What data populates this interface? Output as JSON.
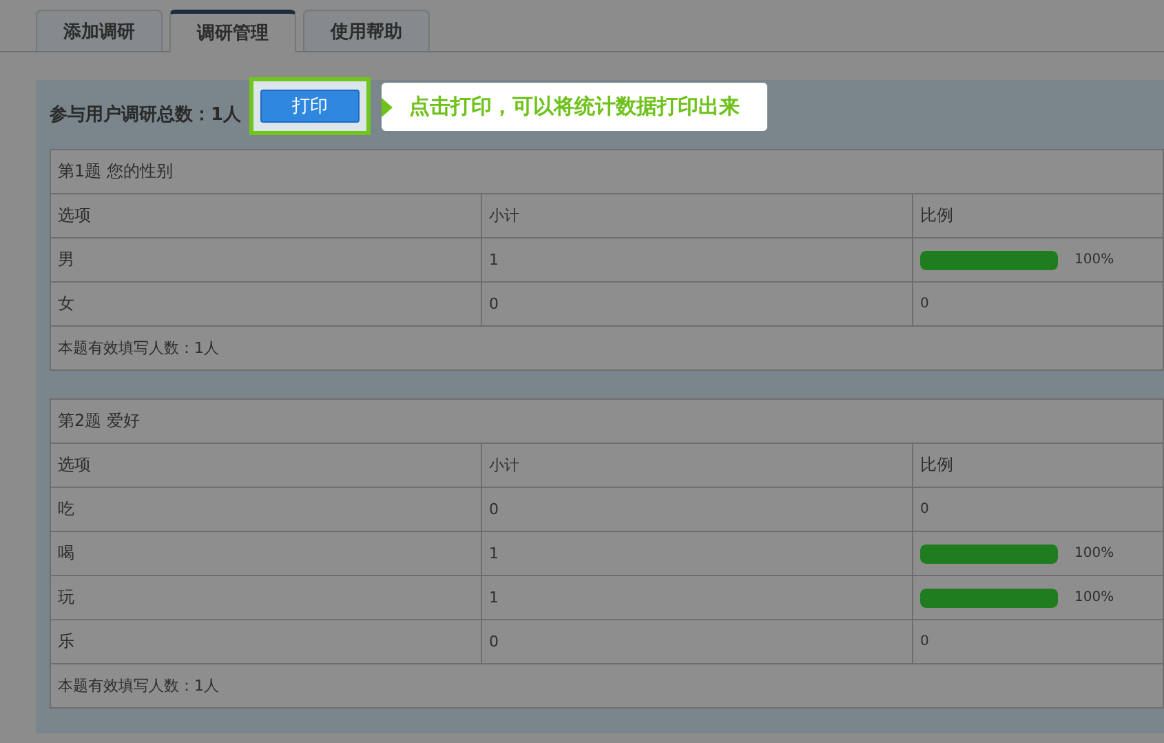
{
  "tabs": [
    {
      "label": "添加调研",
      "selected": false
    },
    {
      "label": "调研管理",
      "selected": true
    },
    {
      "label": "使用帮助",
      "selected": false
    }
  ],
  "summary": "参与用户调研总数：1人",
  "print_button": "打印",
  "callout": "点击打印，可以将统计数据打印出来",
  "questions": [
    {
      "title": "第1题 您的性别",
      "columns": [
        "选项",
        "小计",
        "比例"
      ],
      "rows": [
        {
          "option": "男",
          "count": "1",
          "ratio": "100%",
          "level": 1
        },
        {
          "option": "女",
          "count": "0",
          "ratio": "0"
        }
      ],
      "footer": "本题有效填写人数：1人"
    },
    {
      "title": "第2题 爱好",
      "columns": [
        "选项",
        "小计",
        "比例"
      ],
      "rows": [
        {
          "option": "吃",
          "count": "0",
          "ratio": "0"
        },
        {
          "option": "喝",
          "count": "1",
          "ratio": "100%",
          "level": 1
        },
        {
          "option": "玩",
          "count": "1",
          "ratio": "100%",
          "level": 1
        },
        {
          "option": "乐",
          "count": "0",
          "ratio": "0"
        }
      ],
      "footer": "本题有效填写人数：1人"
    }
  ]
}
